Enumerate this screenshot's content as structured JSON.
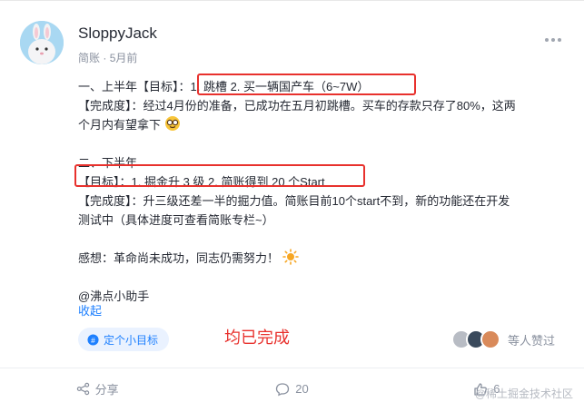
{
  "post": {
    "username": "SloppyJack",
    "source": "简账",
    "time": "5月前",
    "content": {
      "line1_prefix": "一、上半年【目标】：",
      "line1_goal": "1. 跳槽 2. 买一辆国产车（6~7W）",
      "line2": "【完成度】：经过4月份的准备，已成功在五月初跳槽。买车的存款只存了80%，这两",
      "line3": "个月内有望拿下",
      "line4": "二、下半年",
      "line5": "【目标】：1. 掘金升 3 级 2. 简账得到 20 个Start",
      "line6": "【完成度】：升三级还差一半的掘力值。简账目前10个start不到，新的功能还在开发",
      "line7": "测试中（具体进度可查看简账专栏~）",
      "line8": "感想：革命尚未成功，同志仍需努力！",
      "line9": "@沸点小助手"
    },
    "collapse_label": "收起",
    "topic_label": "定个小目标",
    "annotation_text": "均已完成",
    "likers_text": "等人赞过"
  },
  "actions": {
    "share_label": "分享",
    "comment_count": "20",
    "like_count": "6"
  },
  "watermark": "@稀土掘金技术社区",
  "colors": {
    "accent": "#1e80ff",
    "annotation_red": "#e8312d",
    "muted": "#8a919f"
  },
  "icons": [
    "more-icon",
    "emoji-nerd-icon",
    "sun-icon",
    "topic-icon",
    "share-icon",
    "comment-icon",
    "like-icon"
  ]
}
